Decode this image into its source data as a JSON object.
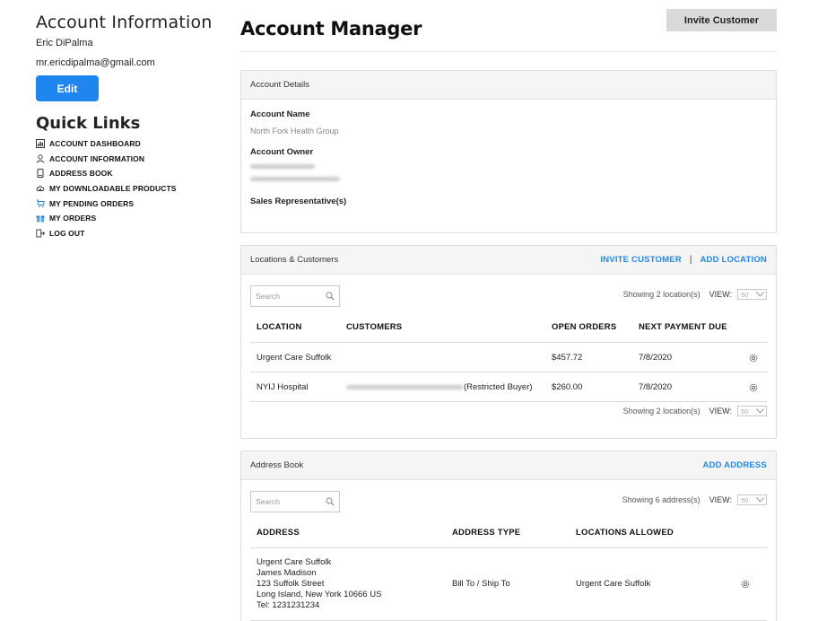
{
  "sidebar": {
    "title": "Account Information",
    "name": "Eric DiPalma",
    "email": "mr.ericdipalma@gmail.com",
    "edit_label": "Edit",
    "quick_links_title": "Quick Links",
    "links": [
      {
        "label": "ACCOUNT DASHBOARD",
        "icon": "dashboard-icon"
      },
      {
        "label": "ACCOUNT INFORMATION",
        "icon": "user-icon"
      },
      {
        "label": "ADDRESS BOOK",
        "icon": "book-icon"
      },
      {
        "label": "MY DOWNLOADABLE PRODUCTS",
        "icon": "cloud-download-icon"
      },
      {
        "label": "MY PENDING ORDERS",
        "icon": "cart-icon"
      },
      {
        "label": "MY ORDERS",
        "icon": "gift-icon"
      },
      {
        "label": "LOG OUT",
        "icon": "logout-icon"
      }
    ]
  },
  "header": {
    "title": "Account Manager",
    "invite_label": "Invite Customer"
  },
  "account_details": {
    "heading": "Account Details",
    "name_label": "Account Name",
    "name_value": "North Fork Health Group",
    "owner_label": "Account Owner",
    "sales_label": "Sales Representative(s)"
  },
  "locations": {
    "heading": "Locations & Customers",
    "invite_link": "INVITE CUSTOMER",
    "separator": "|",
    "add_link": "ADD LOCATION",
    "search_placeholder": "Search",
    "showing": "Showing 2 location(s)",
    "view_label": "VIEW:",
    "view_value": "50",
    "columns": [
      "LOCATION",
      "CUSTOMERS",
      "OPEN ORDERS",
      "NEXT PAYMENT DUE"
    ],
    "rows": [
      {
        "location": "Urgent Care Suffolk",
        "customer_note": "",
        "open_orders": "$457.72",
        "next_payment": "7/8/2020"
      },
      {
        "location": "NYIJ Hospital",
        "customer_note": "(Restricted Buyer)",
        "open_orders": "$260.00",
        "next_payment": "7/8/2020"
      }
    ]
  },
  "address_book": {
    "heading": "Address Book",
    "add_link": "ADD ADDRESS",
    "search_placeholder": "Search",
    "showing": "Showing 6 address(s)",
    "view_label": "VIEW:",
    "view_value": "50",
    "columns": [
      "ADDRESS",
      "ADDRESS TYPE",
      "LOCATIONS ALLOWED"
    ],
    "rows": [
      {
        "address_lines": [
          "Urgent Care Suffolk",
          "James Madison",
          "123 Suffolk Street",
          "Long Island, New York 10666 US",
          "Tel: 1231231234"
        ],
        "type": "Bill To / Ship To",
        "locations_allowed": "Urgent Care Suffolk"
      }
    ]
  },
  "colors": {
    "accent": "#1f86f0",
    "invite_button_bg": "#d9d9d9",
    "panel_header_bg": "#f5f5f5"
  }
}
